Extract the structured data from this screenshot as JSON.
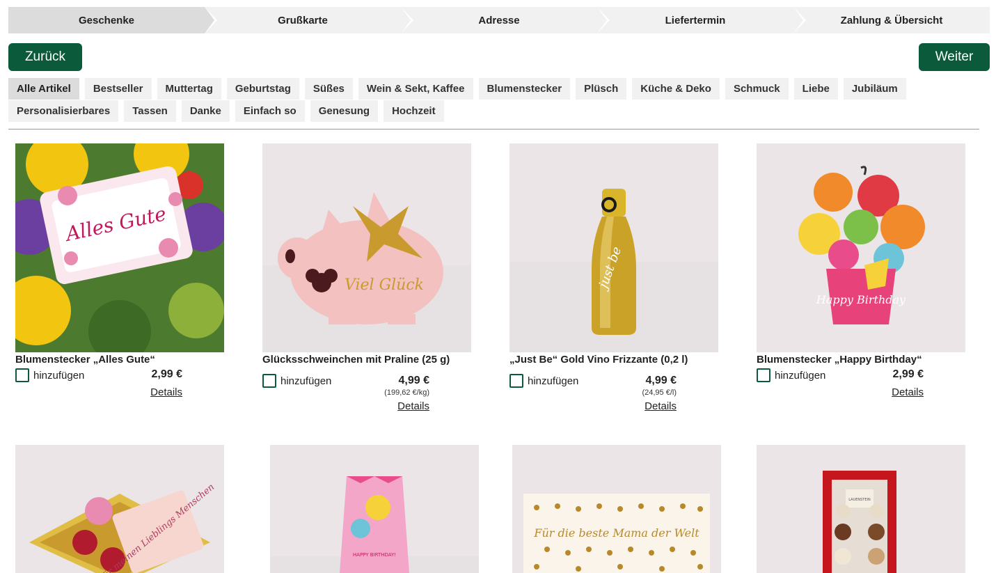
{
  "steps": [
    {
      "label": "Geschenke"
    },
    {
      "label": "Grußkarte"
    },
    {
      "label": "Adresse"
    },
    {
      "label": "Liefertermin"
    },
    {
      "label": "Zahlung & Übersicht"
    }
  ],
  "nav": {
    "back": "Zurück",
    "next": "Weiter"
  },
  "categories_row1": [
    "Alle Artikel",
    "Bestseller",
    "Muttertag",
    "Geburtstag",
    "Süßes",
    "Wein & Sekt, Kaffee",
    "Blumenstecker",
    "Plüsch",
    "Küche & Deko",
    "Schmuck",
    "Liebe",
    "Jubiläum"
  ],
  "categories_row2": [
    "Personalisierbares",
    "Tassen",
    "Danke",
    "Einfach so",
    "Genesung",
    "Hochzeit"
  ],
  "products": [
    {
      "name": "Blumenstecker „Alles Gute“",
      "add_label": "hinzufügen",
      "price": "2,99 €",
      "unit_price": "",
      "details": "Details",
      "image_text": "Alles Gute"
    },
    {
      "name": "Glücksschweinchen mit Praline (25 g)",
      "add_label": "hinzufügen",
      "price": "4,99 €",
      "unit_price": "(199,62 €/kg)",
      "details": "Details",
      "image_text": "Viel Glück"
    },
    {
      "name": "„Just Be“ Gold Vino Frizzante (0,2 l)",
      "add_label": "hinzufügen",
      "price": "4,99 €",
      "unit_price": "(24,95 €/l)",
      "details": "Details",
      "image_text": "just be"
    },
    {
      "name": "Blumenstecker „Happy Birthday“",
      "add_label": "hinzufügen",
      "price": "2,99 €",
      "unit_price": "",
      "details": "Details",
      "image_text": "Happy Birthday"
    },
    {
      "image_text": "Für meinen Lieblings Menschen"
    },
    {
      "image_text": "HAPPY BIRTHDAY!"
    },
    {
      "image_text": "Für die beste Mama der Welt"
    },
    {
      "image_text": "LAUENSTEIN"
    }
  ],
  "colors": {
    "accent": "#0a5a3b",
    "chip_bg": "#f1f1f1",
    "chip_active": "#dcdcdc"
  }
}
